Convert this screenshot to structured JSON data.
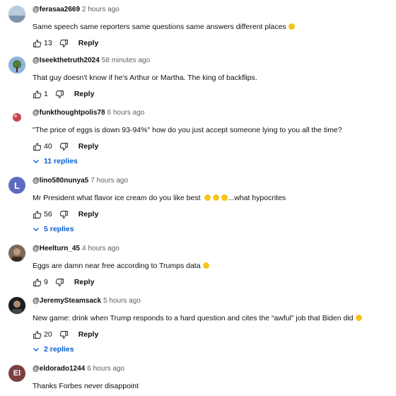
{
  "comments": [
    {
      "author": "@ferasaa2669",
      "time": "2 hours ago",
      "text": "Same speech same reporters same questions same answers different places",
      "likes": "13",
      "reply_label": "Reply",
      "avatar_color": "#9fb6c9",
      "has_emoji": true
    },
    {
      "author": "@Iseekthetruth2024",
      "time": "58 minutes ago",
      "text": "That guy doesn't know if he's Arthur or Martha. The king of backflips.",
      "likes": "1",
      "reply_label": "Reply",
      "avatar_color": "#5d8fc7"
    },
    {
      "author": "@funkthoughtpolis78",
      "time": "6 hours ago",
      "text": "\"The price of eggs is down 93-94%\" how do you just accept someone lying to you all the time?",
      "likes": "40",
      "reply_label": "Reply",
      "replies": "11 replies",
      "avatar_color": "#c8434e"
    },
    {
      "author": "@lino580nunya5",
      "time": "7 hours ago",
      "text": "Mr President what flavor ice cream do you like best",
      "text_suffix": "...what hypocrites",
      "likes": "56",
      "reply_label": "Reply",
      "replies": "5 replies",
      "avatar_letter": "L",
      "avatar_color": "#5c6bc0"
    },
    {
      "author": "@Heelturn_45",
      "time": "4 hours ago",
      "text": "Eggs are damn near free according to Trumps data",
      "likes": "9",
      "reply_label": "Reply",
      "avatar_color": "#6b4a3a",
      "has_emoji": true
    },
    {
      "author": "@JeremySteamsack",
      "time": "5 hours ago",
      "text": "New game: drink when Trump responds to a hard question and cites the “awful” job that Biden did",
      "likes": "20",
      "reply_label": "Reply",
      "replies": "2 replies",
      "avatar_color": "#2b2b2b",
      "has_emoji": true
    },
    {
      "author": "@eldorado1244",
      "time": "6 hours ago",
      "text": "Thanks Forbes never disappoint",
      "avatar_letter": "El",
      "avatar_color": "#7b3f3f"
    }
  ]
}
